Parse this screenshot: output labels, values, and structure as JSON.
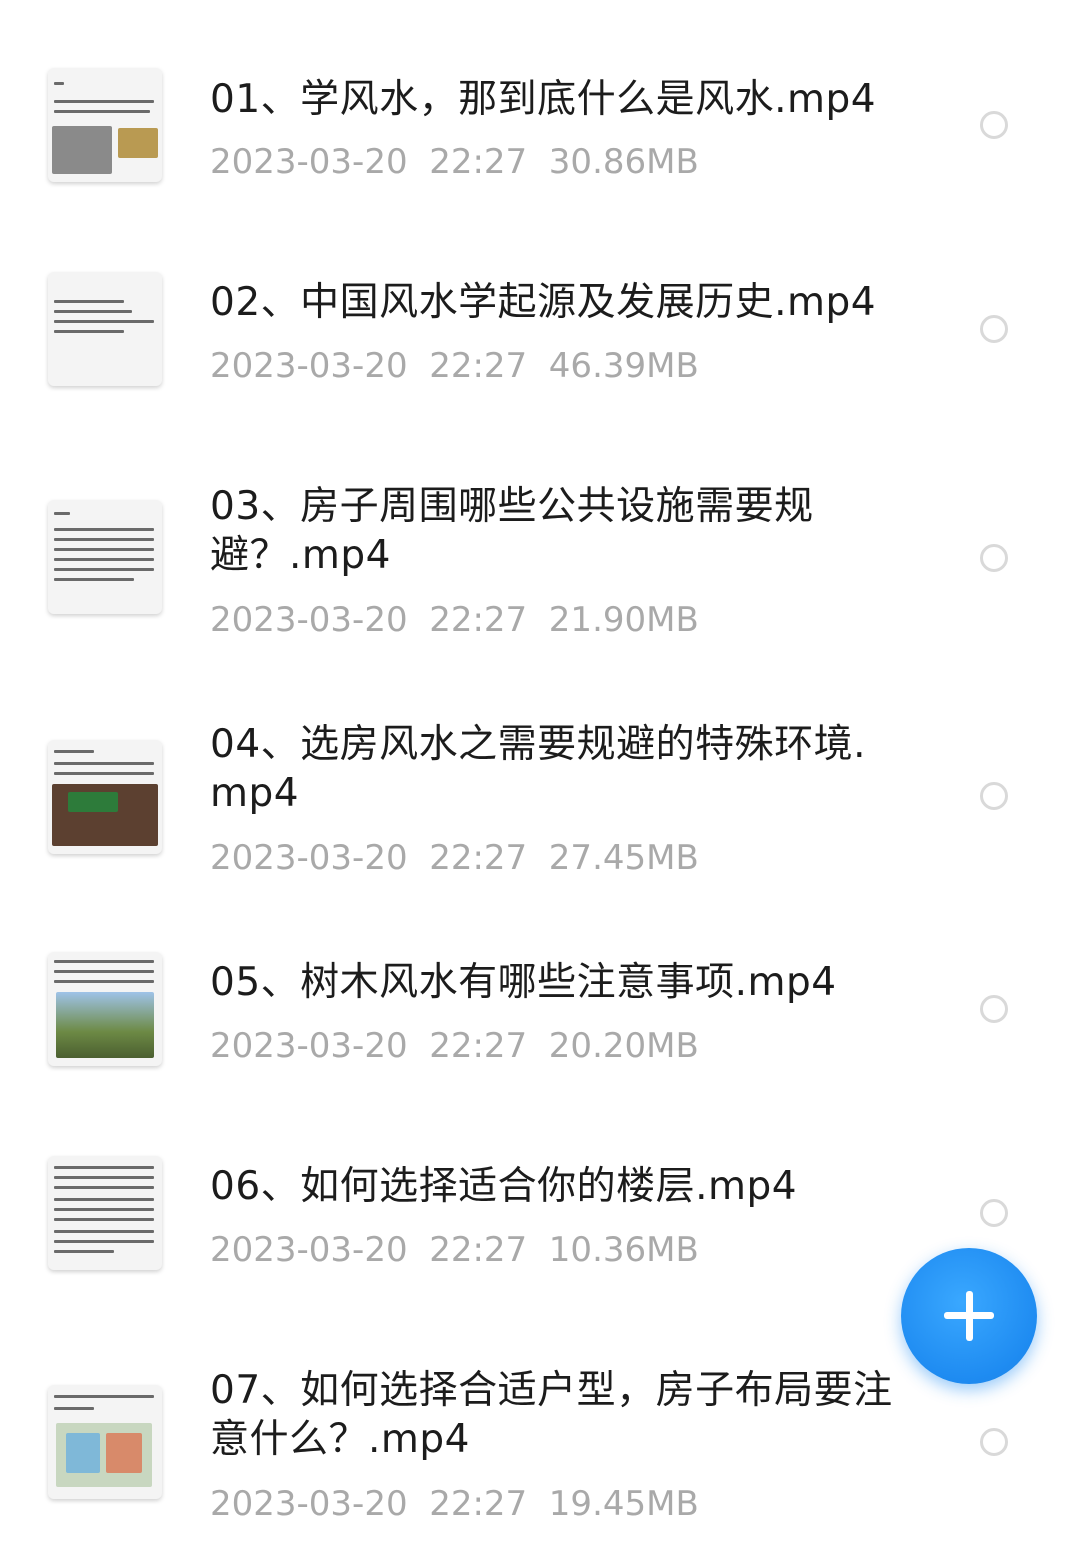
{
  "files": [
    {
      "name": "01、学风水，那到底什么是风水.mp4",
      "meta": "2023-03-20  22:27  30.86MB",
      "thumbnail_icon": "video-thumbnail-icon"
    },
    {
      "name": "02、中国风水学起源及发展历史.mp4",
      "meta": "2023-03-20  22:27  46.39MB",
      "thumbnail_icon": "video-thumbnail-icon"
    },
    {
      "name": "03、房子周围哪些公共设施需要规避？.mp4",
      "meta": "2023-03-20  22:27  21.90MB",
      "thumbnail_icon": "video-thumbnail-icon"
    },
    {
      "name": "04、选房风水之需要规避的特殊环境.mp4",
      "meta": "2023-03-20  22:27  27.45MB",
      "thumbnail_icon": "video-thumbnail-icon"
    },
    {
      "name": "05、树木风水有哪些注意事项.mp4",
      "meta": "2023-03-20  22:27  20.20MB",
      "thumbnail_icon": "video-thumbnail-icon"
    },
    {
      "name": "06、如何选择适合你的楼层.mp4",
      "meta": "2023-03-20  22:27  10.36MB",
      "thumbnail_icon": "video-thumbnail-icon"
    },
    {
      "name": "07、如何选择合适户型，房子布局要注意什么？.mp4",
      "meta": "2023-03-20  22:27  19.45MB",
      "thumbnail_icon": "video-thumbnail-icon"
    }
  ],
  "fab": {
    "icon": "plus-icon",
    "color": "#1e8bf1"
  },
  "colors": {
    "title": "#1c1c1c",
    "meta": "#a9a9a9",
    "radio_border": "#d9d9d9"
  }
}
